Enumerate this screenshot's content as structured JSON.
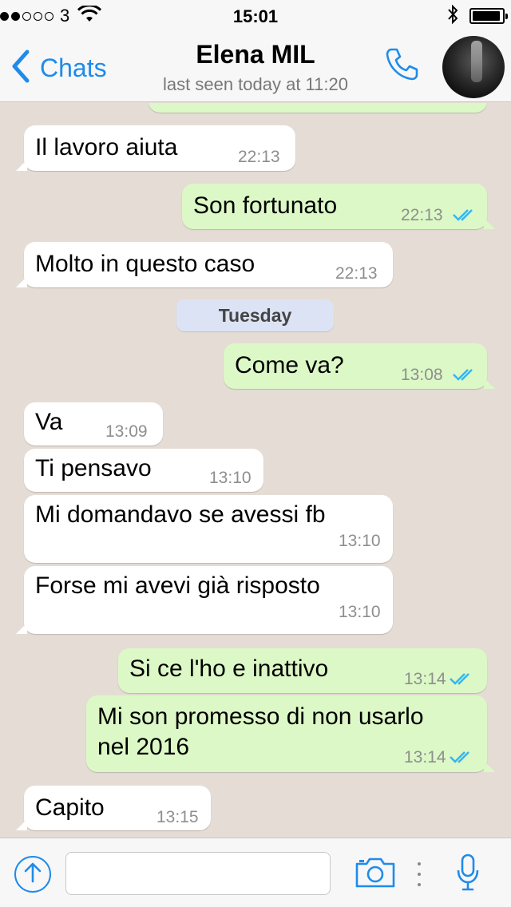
{
  "status_bar": {
    "carrier": "3",
    "time": "15:01",
    "signal_strength": 2,
    "battery_level": 0.95
  },
  "nav": {
    "back_label": "Chats",
    "contact_name": "Elena MIL",
    "last_seen": "last seen today at 11:20"
  },
  "messages": [
    {
      "text": "Il lavoro aiuta",
      "time": "22:13",
      "direction": "incoming"
    },
    {
      "text": "Son fortunato",
      "time": "22:13",
      "direction": "outgoing",
      "status": "read"
    },
    {
      "text": "Molto in questo caso",
      "time": "22:13",
      "direction": "incoming"
    },
    {
      "text": "Come va?",
      "time": "13:08",
      "direction": "outgoing",
      "status": "read"
    },
    {
      "text": "Va",
      "time": "13:09",
      "direction": "incoming"
    },
    {
      "text": "Ti pensavo",
      "time": "13:10",
      "direction": "incoming"
    },
    {
      "text": "Mi domandavo se avessi fb",
      "time": "13:10",
      "direction": "incoming"
    },
    {
      "text": "Forse mi avevi già risposto",
      "time": "13:10",
      "direction": "incoming"
    },
    {
      "text": "Si ce l'ho e inattivo",
      "time": "13:14",
      "direction": "outgoing",
      "status": "read"
    },
    {
      "text_line1": "Mi son promesso di non usarlo",
      "text_line2": "nel 2016",
      "time": "13:14",
      "direction": "outgoing",
      "status": "read"
    },
    {
      "text": "Capito",
      "time": "13:15",
      "direction": "incoming"
    }
  ],
  "day_separator": "Tuesday",
  "input": {
    "placeholder": "",
    "value": ""
  },
  "colors": {
    "accent": "#1f8bea",
    "incoming_bubble": "#ffffff",
    "outgoing_bubble": "#dcf8c6",
    "read_ticks": "#34b7f1",
    "chat_background": "#e5ddd5"
  },
  "icons": {
    "back": "chevron-left-icon",
    "call": "phone-icon",
    "upload": "arrow-up-circle-icon",
    "camera": "camera-icon",
    "mic": "microphone-icon",
    "read": "double-check-icon"
  }
}
